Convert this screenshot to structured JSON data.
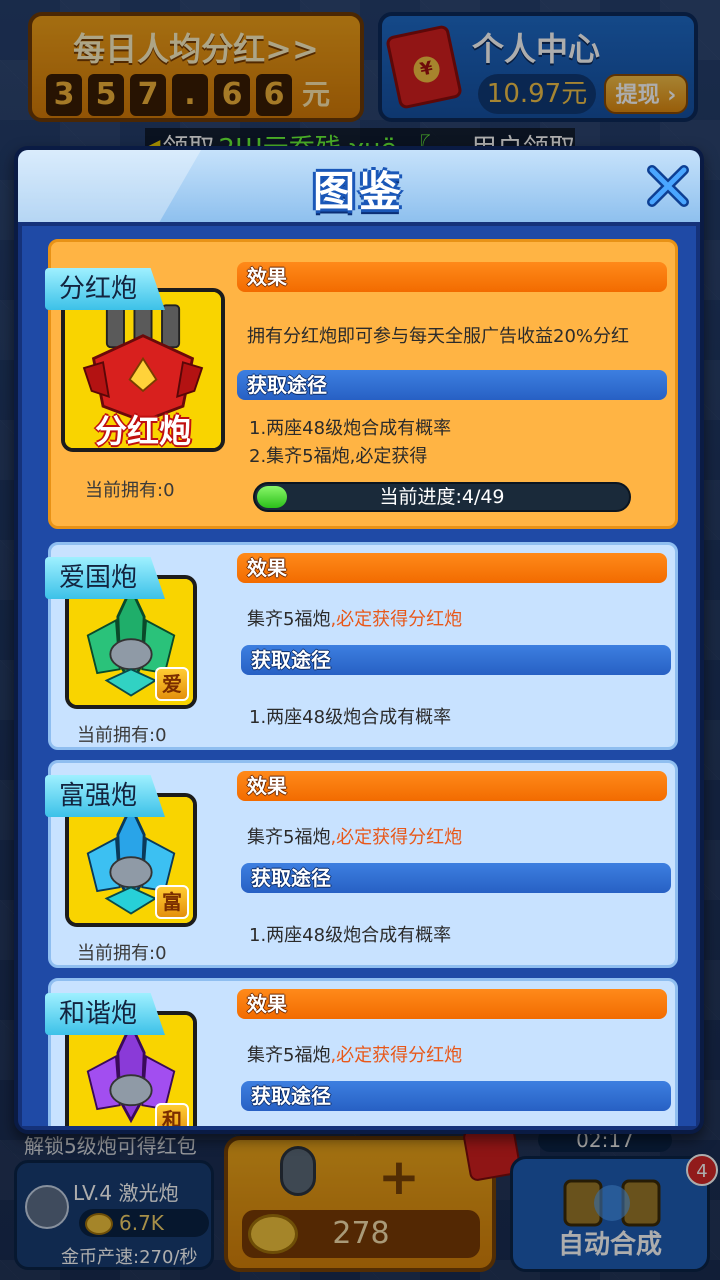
{
  "top": {
    "daily_dividend": {
      "title": "每日人均分红>>",
      "digits": [
        "3",
        "5",
        "7",
        ".",
        "6",
        "6"
      ],
      "unit": "元"
    },
    "personal_center": {
      "title": "个人中心",
      "balance": "10.97元",
      "withdraw_label": "提现"
    },
    "ticker": {
      "left_text": "领取",
      "green_text": "2Ш元乔残 χμë 〖",
      "right_text": "用户领取"
    }
  },
  "modal": {
    "title": "图鉴",
    "close_icon": "close-x-icon",
    "cards": [
      {
        "name": "分红炮",
        "portrait_label": "分红炮",
        "owned": "当前拥有:0",
        "effect_label": "效果",
        "effect_text": "拥有分红炮即可参与每天全服广告收益20%分红",
        "source_label": "获取途径",
        "sources": [
          "1.两座48级炮合成有概率",
          "2.集齐5福炮,必定获得"
        ],
        "progress_label": "当前进度:4/49",
        "progress_fraction": 0.08
      },
      {
        "name": "爱国炮",
        "badge": "爱",
        "owned": "当前拥有:0",
        "effect_label": "效果",
        "effect_prefix": "集齐5福炮",
        "effect_highlight": ",必定获得分红炮",
        "source_label": "获取途径",
        "source_text": "1.两座48级炮合成有概率"
      },
      {
        "name": "富强炮",
        "badge": "富",
        "owned": "当前拥有:0",
        "effect_label": "效果",
        "effect_prefix": "集齐5福炮",
        "effect_highlight": ",必定获得分红炮",
        "source_label": "获取途径",
        "source_text": "1.两座48级炮合成有概率"
      },
      {
        "name": "和谐炮",
        "badge": "和",
        "effect_label": "效果",
        "effect_prefix": "集齐5福炮",
        "effect_highlight": ",必定获得分红炮",
        "source_label": "获取途径"
      }
    ]
  },
  "bottom": {
    "unlock_tip": "解锁5级炮可得红包",
    "level_card": {
      "name": "LV.4 激光炮",
      "cost": "6.7K",
      "speed": "金币产速:270/秒"
    },
    "buy": {
      "plus": "+",
      "price": "278"
    },
    "timer": "02:17",
    "auto_merge": {
      "label": "自动合成",
      "badge_count": "4"
    }
  },
  "colors": {
    "modal_bg": "#15327a",
    "gold_card": "#ffb444",
    "blue_card": "#c8e2ff",
    "effect_bar": "#f26b00",
    "source_bar": "#2760c4",
    "highlight_text": "#e8581a",
    "progress_green": "#2bbf1a"
  }
}
